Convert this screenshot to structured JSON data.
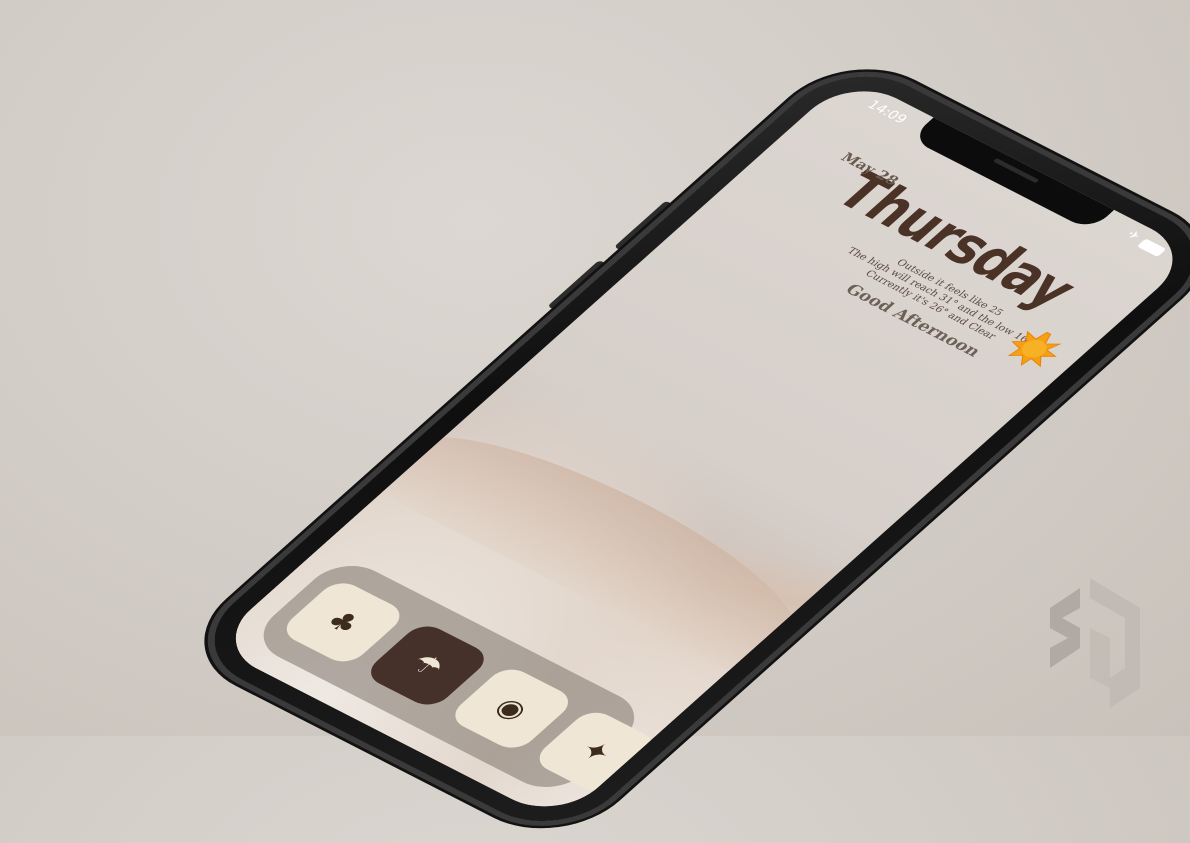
{
  "status_bar": {
    "time": "14:09",
    "airplane_icon": "airplane-icon",
    "battery_icon": "battery-icon"
  },
  "widget": {
    "day": "Thursday",
    "date": "May 28",
    "weather_line1": "Outside it feels like 25",
    "weather_line2": "The high will reach 31° and the low 16°",
    "weather_line3": "Currently it's 26° and Clear",
    "greeting": "Good Afternoon",
    "weather_icon": "sun-icon"
  },
  "dock": {
    "apps": [
      {
        "icon": "clover-icon",
        "glyph": "♣"
      },
      {
        "icon": "parachute-icon",
        "glyph": "☂"
      },
      {
        "icon": "camera-icon",
        "glyph": "◉"
      },
      {
        "icon": "compass-icon",
        "glyph": "✦"
      }
    ]
  },
  "colors": {
    "text_brown": "#4a3226",
    "icon_cream": "#efe6d5",
    "icon_dark": "#46302a",
    "sun_orange": "#f4a012"
  }
}
